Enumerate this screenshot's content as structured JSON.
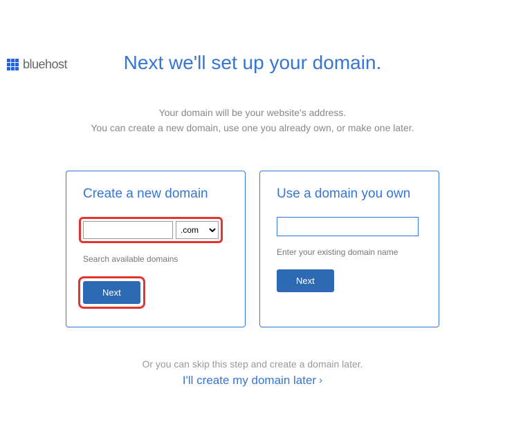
{
  "logo": {
    "text": "bluehost"
  },
  "heading": "Next we'll set up your domain.",
  "subhead": {
    "line1": "Your domain will be your website's address.",
    "line2": "You can create a new domain, use one you already own, or make one later."
  },
  "panels": {
    "create": {
      "title": "Create a new domain",
      "tld_options": [
        ".com"
      ],
      "tld_selected": ".com",
      "help": "Search available domains",
      "button": "Next"
    },
    "own": {
      "title": "Use a domain you own",
      "help": "Enter your existing domain name",
      "button": "Next"
    }
  },
  "skip": {
    "text": "Or you can skip this step and create a domain later.",
    "link": "I'll create my domain later"
  }
}
